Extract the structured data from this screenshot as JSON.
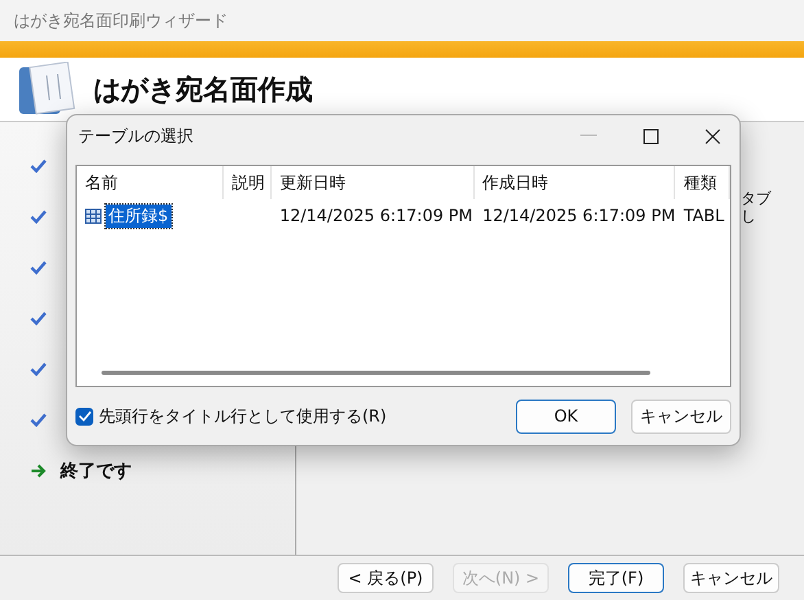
{
  "window": {
    "title": "はがき宛名面印刷ウィザード"
  },
  "header": {
    "title": "はがき宛名面作成"
  },
  "steps": [
    {
      "kind": "done"
    },
    {
      "kind": "done"
    },
    {
      "kind": "done"
    },
    {
      "kind": "done"
    },
    {
      "kind": "done"
    },
    {
      "kind": "done"
    },
    {
      "label": "終了です",
      "kind": "current"
    }
  ],
  "content_fragments": [
    "タブ",
    "し"
  ],
  "footer_buttons": [
    {
      "label": "< 戻る(P)",
      "disabled": false,
      "default": false
    },
    {
      "label": "次へ(N) >",
      "disabled": true,
      "default": false
    },
    {
      "label": "完了(F)",
      "disabled": false,
      "default": true
    },
    {
      "label": "キャンセル",
      "disabled": false,
      "default": false
    }
  ],
  "dialog": {
    "title": "テーブルの選択",
    "table": {
      "columns": [
        "名前",
        "説明",
        "更新日時",
        "作成日時",
        "種類"
      ],
      "rows": [
        {
          "cells": [
            "住所録$",
            "",
            "12/14/2025 6:17:09 PM",
            "12/14/2025 6:17:09 PM",
            "TABL"
          ],
          "selected": true
        }
      ]
    },
    "checkbox": {
      "label": "先頭行をタイトル行として使用する(R)",
      "checked": true
    },
    "buttons": [
      {
        "label": "OK",
        "default": true
      },
      {
        "label": "キャンセル",
        "default": false
      }
    ]
  }
}
